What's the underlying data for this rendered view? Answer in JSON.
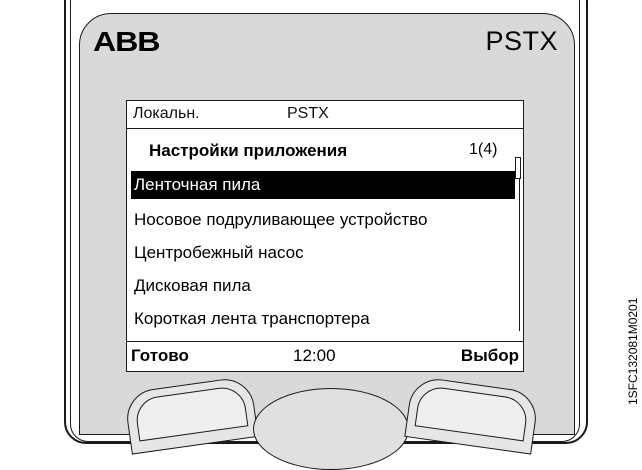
{
  "device": {
    "brand": "ABB",
    "model": "PSTX"
  },
  "screen": {
    "status": {
      "mode": "Локальн.",
      "device": "PSTX"
    },
    "menu": {
      "title": "Настройки приложения",
      "page": "1(4)",
      "items": [
        {
          "label": "Ленточная пила",
          "selected": true
        },
        {
          "label": "Носовое подруливающее устройство",
          "selected": false
        },
        {
          "label": "Центробежный насос",
          "selected": false
        },
        {
          "label": "Дисковая пила",
          "selected": false
        },
        {
          "label": "Короткая лента транспортера",
          "selected": false
        }
      ],
      "scroll_position": 0.0
    },
    "softkeys": {
      "left": "Готово",
      "time": "12:00",
      "right": "Выбор"
    }
  },
  "doc_code": "1SFC132081M0201",
  "colors": {
    "bezel": "#d9d9d9",
    "selection_bg": "#000000",
    "selection_fg": "#ffffff"
  }
}
